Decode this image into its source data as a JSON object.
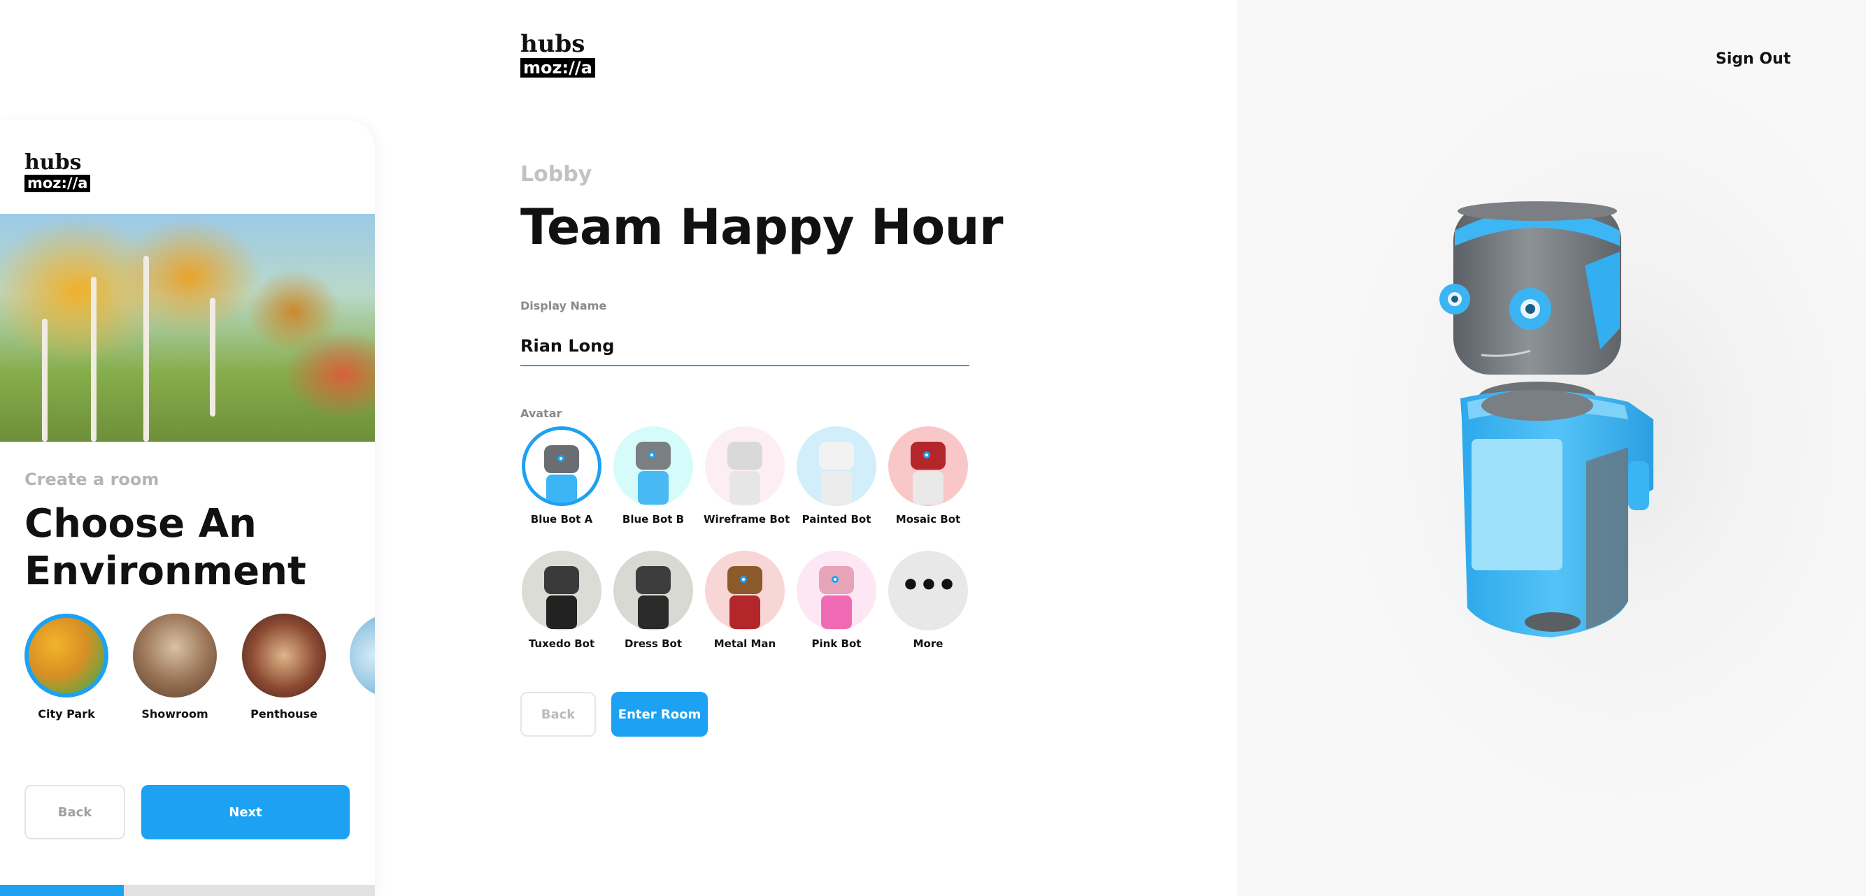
{
  "colors": {
    "accent": "#1da1f2",
    "muted_text": "#b5b5b5",
    "preview_bg": "#f3f3f3"
  },
  "branding": {
    "wordmark": "hubs",
    "sub": "moz://a"
  },
  "header": {
    "sign_out": "Sign Out"
  },
  "mobile": {
    "subtitle": "Create a room",
    "title": "Choose An Environment",
    "environments": [
      {
        "label": "City Park",
        "selected": true
      },
      {
        "label": "Showroom",
        "selected": false
      },
      {
        "label": "Penthouse",
        "selected": false
      },
      {
        "label": "",
        "selected": false
      }
    ],
    "back_label": "Back",
    "next_label": "Next",
    "progress": 0.33
  },
  "lobby": {
    "label": "Lobby",
    "room_title": "Team Happy Hour",
    "display_name_label": "Display Name",
    "display_name_value": "Rian Long",
    "avatar_label": "Avatar",
    "avatars": [
      {
        "name": "Blue Bot A",
        "selected": true,
        "bg": "#ffffff",
        "head": "#6a6e72",
        "body": "#3db5f5"
      },
      {
        "name": "Blue Bot B",
        "selected": false,
        "bg": "#d6fbfb",
        "head": "#7a7f84",
        "body": "#48b9f2"
      },
      {
        "name": "Wireframe Bot",
        "selected": false,
        "bg": "#fdeef3",
        "head": "#d9d9d9",
        "body": "#e6e6e6"
      },
      {
        "name": "Painted Bot",
        "selected": false,
        "bg": "#d2eefb",
        "head": "#f2f2f2",
        "body": "#ececec"
      },
      {
        "name": "Mosaic Bot",
        "selected": false,
        "bg": "#f9c7c7",
        "head": "#b3262a",
        "body": "#e9e9e9"
      },
      {
        "name": "Tuxedo Bot",
        "selected": false,
        "bg": "#dcdcd6",
        "head": "#3a3a3a",
        "body": "#222222"
      },
      {
        "name": "Dress Bot",
        "selected": false,
        "bg": "#d9d9d4",
        "head": "#3d3d3d",
        "body": "#2a2a2a"
      },
      {
        "name": "Metal Man",
        "selected": false,
        "bg": "#f9d6d6",
        "head": "#8a5a2a",
        "body": "#b3262a"
      },
      {
        "name": "Pink Bot",
        "selected": false,
        "bg": "#fde7f5",
        "head": "#e7a3b8",
        "body": "#f06ab4"
      }
    ],
    "more_label": "More",
    "more_icon": "•••",
    "back_label": "Back",
    "enter_label": "Enter Room"
  }
}
